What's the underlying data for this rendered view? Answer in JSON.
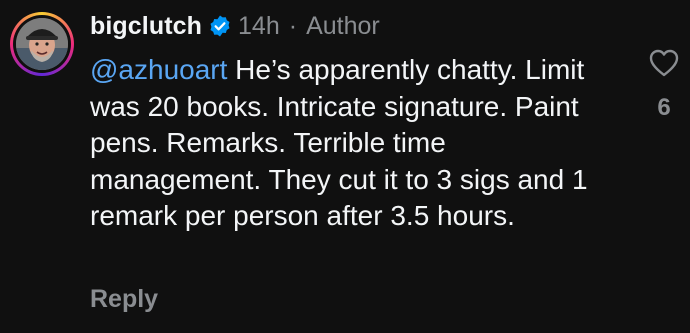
{
  "comment": {
    "username": "bigclutch",
    "time": "14h",
    "separator": "·",
    "role_badge": "Author",
    "mention": "@azhuoart",
    "text": "He’s apparently chatty. Limit was 20 books. Intricate signature. Paint pens. Remarks. Terrible time management. They cut it to 3 sigs and 1 remark per person after 3.5 hours.",
    "reply_label": "Reply",
    "like_count": "6"
  },
  "icons": {
    "verified": "verified-badge-icon",
    "like": "heart-outline-icon",
    "avatar": "profile-photo"
  },
  "colors": {
    "background": "#101010",
    "primary_text": "#f3f5f7",
    "secondary_text": "#8a8d91",
    "mention": "#5aa6f3",
    "verified": "#0095f6"
  }
}
